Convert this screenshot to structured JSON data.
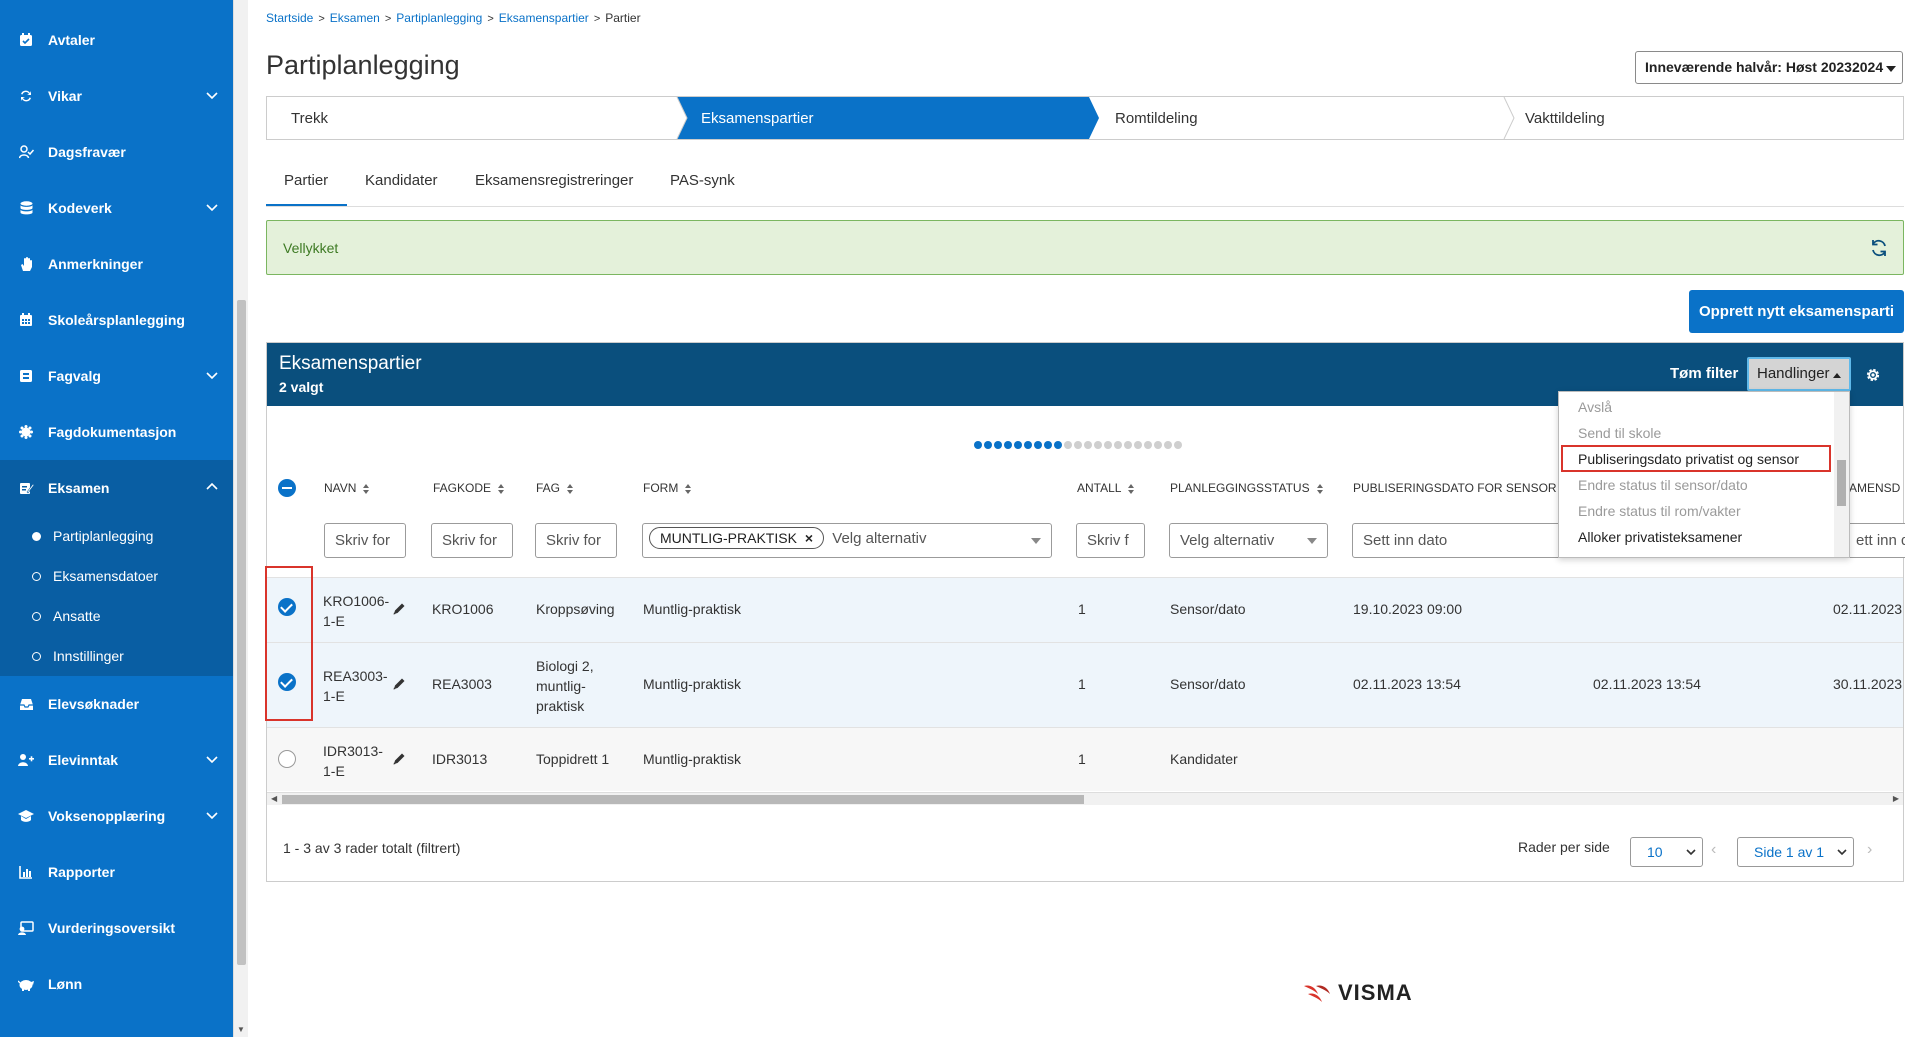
{
  "sidebar": {
    "items": [
      {
        "label": "Avtaler",
        "icon": "calendar-check-icon"
      },
      {
        "label": "Vikar",
        "icon": "swap-icon",
        "expandable": true
      },
      {
        "label": "Dagsfravær",
        "icon": "user-check-icon"
      },
      {
        "label": "Kodeverk",
        "icon": "database-icon",
        "expandable": true
      },
      {
        "label": "Anmerkninger",
        "icon": "hand-icon"
      },
      {
        "label": "Skoleårsplanlegging",
        "icon": "calendar-grid-icon"
      },
      {
        "label": "Fagvalg",
        "icon": "list-box-icon",
        "expandable": true
      },
      {
        "label": "Fagdokumentasjon",
        "icon": "gear-flower-icon"
      },
      {
        "label": "Eksamen",
        "icon": "edit-doc-icon",
        "expandable": true,
        "expanded": true
      },
      {
        "label": "Elevsøknader",
        "icon": "inbox-icon"
      },
      {
        "label": "Elevinntak",
        "icon": "user-plus-icon",
        "expandable": true
      },
      {
        "label": "Voksenopplæring",
        "icon": "school-icon",
        "expandable": true
      },
      {
        "label": "Rapporter",
        "icon": "chart-icon"
      },
      {
        "label": "Vurderingsoversikt",
        "icon": "monitor-user-icon"
      },
      {
        "label": "Lønn",
        "icon": "piggy-bank-icon"
      }
    ],
    "subitems": [
      {
        "label": "Partiplanlegging",
        "active": true
      },
      {
        "label": "Eksamensdatoer",
        "active": false
      },
      {
        "label": "Ansatte",
        "active": false
      },
      {
        "label": "Innstillinger",
        "active": false
      }
    ]
  },
  "breadcrumb": [
    "Startside",
    "Eksamen",
    "Partiplanlegging",
    "Eksamenspartier",
    "Partier"
  ],
  "page_title": "Partiplanlegging",
  "term_select": "Inneværende halvår: Høst 20232024",
  "wizard": [
    "Trekk",
    "Eksamenspartier",
    "Romtildeling",
    "Vakttildeling"
  ],
  "wizard_active": 1,
  "tabs": [
    "Partier",
    "Kandidater",
    "Eksamensregistreringer",
    "PAS-synk"
  ],
  "alert": {
    "text": "Vellykket",
    "icon": "refresh-icon"
  },
  "create_button": "Opprett nytt eksamensparti",
  "panel": {
    "title": "Eksamenspartier",
    "subtitle": "2 valgt",
    "clear_filter": "Tøm filter",
    "actions": "Handlinger",
    "settings_icon": "gear-icon"
  },
  "columns": [
    "NAVN",
    "FAGKODE",
    "FAG",
    "FORM",
    "ANTALL",
    "PLANLEGGINGSSTATUS",
    "PUBLISERINGSDATO FOR SENSOR",
    "AMENSD"
  ],
  "filters": {
    "navn": "Skriv for",
    "fagkode": "Skriv for",
    "fag": "Skriv for",
    "form_chip": "MUNTLIG-PRAKTISK",
    "form_chip_remove": "×",
    "form_placeholder": "Velg alternativ",
    "antall": "Skriv f",
    "status": "Velg alternativ",
    "pubdato": "Sett inn dato",
    "last": "ett inn d"
  },
  "rows": [
    {
      "navn1": "KRO1006-",
      "navn2": "1-E",
      "fagkode": "KRO1006",
      "fag": [
        "Kroppsøving"
      ],
      "form": "Muntlig-praktisk",
      "antall": "1",
      "status": "Sensor/dato",
      "pubdato": "19.10.2023 09:00",
      "pubdato2": "",
      "last": "02.11.2023",
      "checked": true
    },
    {
      "navn1": "REA3003-",
      "navn2": "1-E",
      "fagkode": "REA3003",
      "fag": [
        "Biologi 2,",
        "muntlig-",
        "praktisk"
      ],
      "form": "Muntlig-praktisk",
      "antall": "1",
      "status": "Sensor/dato",
      "pubdato": "02.11.2023 13:54",
      "pubdato2": "02.11.2023 13:54",
      "last": "30.11.2023",
      "checked": true
    },
    {
      "navn1": "IDR3013-",
      "navn2": "1-E",
      "fagkode": "IDR3013",
      "fag": [
        "Toppidrett 1"
      ],
      "form": "Muntlig-praktisk",
      "antall": "1",
      "status": "Kandidater",
      "pubdato": "",
      "pubdato2": "",
      "last": "",
      "checked": false
    }
  ],
  "pagination": {
    "info": "1 - 3 av 3 rader totalt (filtrert)",
    "rows_label": "Rader per side",
    "rows_value": "10",
    "page_value": "Side 1 av 1"
  },
  "dropdown_menu": [
    {
      "label": "Avslå",
      "enabled": false
    },
    {
      "label": "Send til skole",
      "enabled": false
    },
    {
      "label": "Publiseringsdato privatist og sensor",
      "enabled": true,
      "highlighted": true
    },
    {
      "label": "Endre status til sensor/dato",
      "enabled": false
    },
    {
      "label": "Endre status til rom/vakter",
      "enabled": false
    },
    {
      "label": "Alloker privatisteksamener",
      "enabled": true
    }
  ],
  "brand": {
    "name": "VISMA",
    "accent": "#0a72c8",
    "header": "#0a4f7d",
    "logo_red": "#d9342b"
  }
}
